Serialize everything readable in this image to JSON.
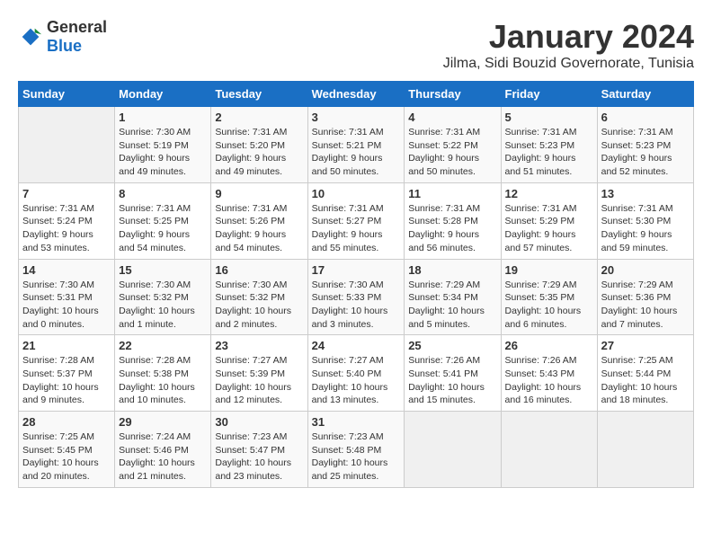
{
  "header": {
    "logo_general": "General",
    "logo_blue": "Blue",
    "title": "January 2024",
    "subtitle": "Jilma, Sidi Bouzid Governorate, Tunisia"
  },
  "calendar": {
    "days_of_week": [
      "Sunday",
      "Monday",
      "Tuesday",
      "Wednesday",
      "Thursday",
      "Friday",
      "Saturday"
    ],
    "weeks": [
      [
        {
          "day": "",
          "info": ""
        },
        {
          "day": "1",
          "info": "Sunrise: 7:30 AM\nSunset: 5:19 PM\nDaylight: 9 hours\nand 49 minutes."
        },
        {
          "day": "2",
          "info": "Sunrise: 7:31 AM\nSunset: 5:20 PM\nDaylight: 9 hours\nand 49 minutes."
        },
        {
          "day": "3",
          "info": "Sunrise: 7:31 AM\nSunset: 5:21 PM\nDaylight: 9 hours\nand 50 minutes."
        },
        {
          "day": "4",
          "info": "Sunrise: 7:31 AM\nSunset: 5:22 PM\nDaylight: 9 hours\nand 50 minutes."
        },
        {
          "day": "5",
          "info": "Sunrise: 7:31 AM\nSunset: 5:23 PM\nDaylight: 9 hours\nand 51 minutes."
        },
        {
          "day": "6",
          "info": "Sunrise: 7:31 AM\nSunset: 5:23 PM\nDaylight: 9 hours\nand 52 minutes."
        }
      ],
      [
        {
          "day": "7",
          "info": "Sunrise: 7:31 AM\nSunset: 5:24 PM\nDaylight: 9 hours\nand 53 minutes."
        },
        {
          "day": "8",
          "info": "Sunrise: 7:31 AM\nSunset: 5:25 PM\nDaylight: 9 hours\nand 54 minutes."
        },
        {
          "day": "9",
          "info": "Sunrise: 7:31 AM\nSunset: 5:26 PM\nDaylight: 9 hours\nand 54 minutes."
        },
        {
          "day": "10",
          "info": "Sunrise: 7:31 AM\nSunset: 5:27 PM\nDaylight: 9 hours\nand 55 minutes."
        },
        {
          "day": "11",
          "info": "Sunrise: 7:31 AM\nSunset: 5:28 PM\nDaylight: 9 hours\nand 56 minutes."
        },
        {
          "day": "12",
          "info": "Sunrise: 7:31 AM\nSunset: 5:29 PM\nDaylight: 9 hours\nand 57 minutes."
        },
        {
          "day": "13",
          "info": "Sunrise: 7:31 AM\nSunset: 5:30 PM\nDaylight: 9 hours\nand 59 minutes."
        }
      ],
      [
        {
          "day": "14",
          "info": "Sunrise: 7:30 AM\nSunset: 5:31 PM\nDaylight: 10 hours\nand 0 minutes."
        },
        {
          "day": "15",
          "info": "Sunrise: 7:30 AM\nSunset: 5:32 PM\nDaylight: 10 hours\nand 1 minute."
        },
        {
          "day": "16",
          "info": "Sunrise: 7:30 AM\nSunset: 5:32 PM\nDaylight: 10 hours\nand 2 minutes."
        },
        {
          "day": "17",
          "info": "Sunrise: 7:30 AM\nSunset: 5:33 PM\nDaylight: 10 hours\nand 3 minutes."
        },
        {
          "day": "18",
          "info": "Sunrise: 7:29 AM\nSunset: 5:34 PM\nDaylight: 10 hours\nand 5 minutes."
        },
        {
          "day": "19",
          "info": "Sunrise: 7:29 AM\nSunset: 5:35 PM\nDaylight: 10 hours\nand 6 minutes."
        },
        {
          "day": "20",
          "info": "Sunrise: 7:29 AM\nSunset: 5:36 PM\nDaylight: 10 hours\nand 7 minutes."
        }
      ],
      [
        {
          "day": "21",
          "info": "Sunrise: 7:28 AM\nSunset: 5:37 PM\nDaylight: 10 hours\nand 9 minutes."
        },
        {
          "day": "22",
          "info": "Sunrise: 7:28 AM\nSunset: 5:38 PM\nDaylight: 10 hours\nand 10 minutes."
        },
        {
          "day": "23",
          "info": "Sunrise: 7:27 AM\nSunset: 5:39 PM\nDaylight: 10 hours\nand 12 minutes."
        },
        {
          "day": "24",
          "info": "Sunrise: 7:27 AM\nSunset: 5:40 PM\nDaylight: 10 hours\nand 13 minutes."
        },
        {
          "day": "25",
          "info": "Sunrise: 7:26 AM\nSunset: 5:41 PM\nDaylight: 10 hours\nand 15 minutes."
        },
        {
          "day": "26",
          "info": "Sunrise: 7:26 AM\nSunset: 5:43 PM\nDaylight: 10 hours\nand 16 minutes."
        },
        {
          "day": "27",
          "info": "Sunrise: 7:25 AM\nSunset: 5:44 PM\nDaylight: 10 hours\nand 18 minutes."
        }
      ],
      [
        {
          "day": "28",
          "info": "Sunrise: 7:25 AM\nSunset: 5:45 PM\nDaylight: 10 hours\nand 20 minutes."
        },
        {
          "day": "29",
          "info": "Sunrise: 7:24 AM\nSunset: 5:46 PM\nDaylight: 10 hours\nand 21 minutes."
        },
        {
          "day": "30",
          "info": "Sunrise: 7:23 AM\nSunset: 5:47 PM\nDaylight: 10 hours\nand 23 minutes."
        },
        {
          "day": "31",
          "info": "Sunrise: 7:23 AM\nSunset: 5:48 PM\nDaylight: 10 hours\nand 25 minutes."
        },
        {
          "day": "",
          "info": ""
        },
        {
          "day": "",
          "info": ""
        },
        {
          "day": "",
          "info": ""
        }
      ]
    ]
  }
}
